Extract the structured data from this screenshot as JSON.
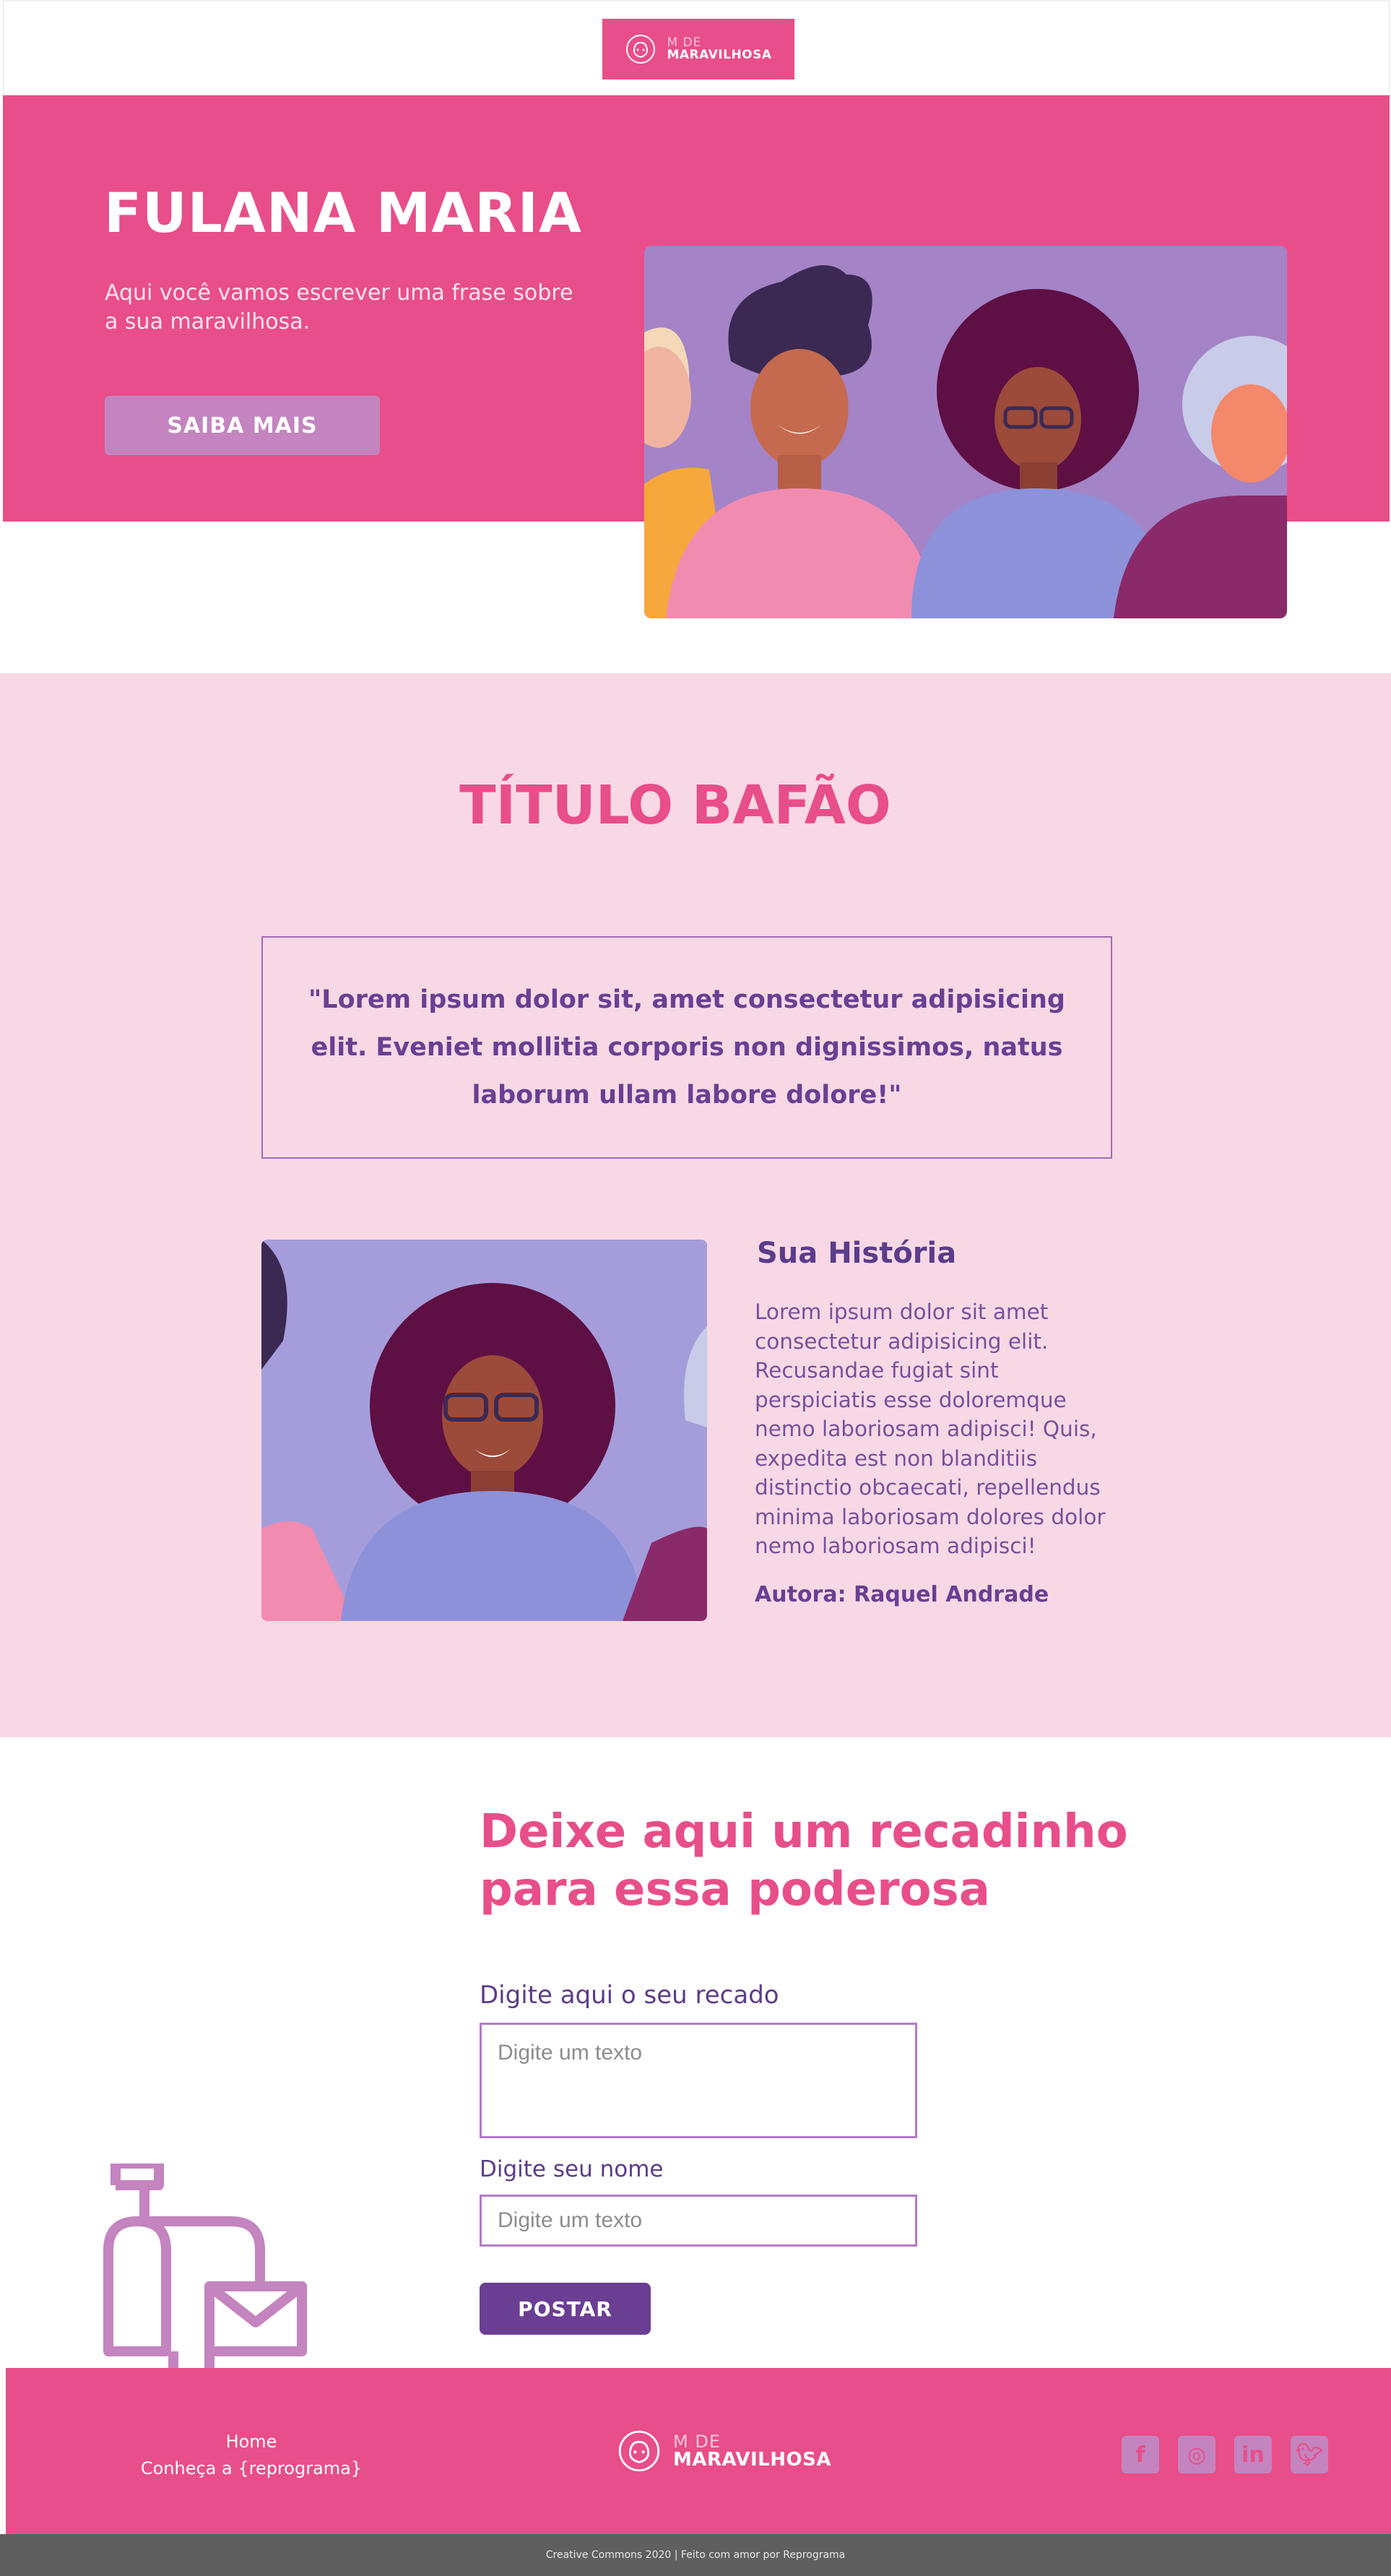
{
  "header": {
    "logo_small": "M DE",
    "logo_big": "MARAVILHOSA"
  },
  "hero": {
    "title": "FULANA MARIA",
    "subtitle": "Aqui você vamos escrever uma frase sobre a sua maravilhosa.",
    "button_label": "SAIBA MAIS"
  },
  "story": {
    "section_title": "TÍTULO BAFÃO",
    "quote": "\"Lorem ipsum dolor sit, amet consectetur adipisicing elit. Eveniet mollitia corporis non dignissimos, natus laborum ullam labore dolore!\"",
    "heading": "Sua História",
    "body": "Lorem ipsum dolor sit amet consectetur adipisicing elit. Recusandae fugiat sint perspiciatis esse doloremque nemo laboriosam adipisci! Quis, expedita est non blanditiis distinctio obcaecati, repellendus minima laboriosam dolores dolor nemo laboriosam adipisci!",
    "author": "Autora: Raquel Andrade"
  },
  "message": {
    "title": "Deixe aqui um recadinho para essa poderosa",
    "message_label": "Digite aqui o seu recado",
    "message_placeholder": "Digite um texto",
    "name_label": "Digite seu nome",
    "name_placeholder": "Digite um texto",
    "post_label": "POSTAR"
  },
  "footer": {
    "links": [
      "Home",
      "Conheça a {reprograma}"
    ],
    "logo_small": "M DE",
    "logo_big": "MARAVILHOSA",
    "socials": [
      "facebook-icon",
      "instagram-icon",
      "linkedin-icon",
      "twitter-icon"
    ],
    "copyright": "Creative Commons 2020 | Feito com amor por Reprograma"
  },
  "colors": {
    "brand_pink": "#e84e89",
    "light_pink": "#f8d8e5",
    "purple": "#6a3f93",
    "lilac": "#c484bf"
  }
}
